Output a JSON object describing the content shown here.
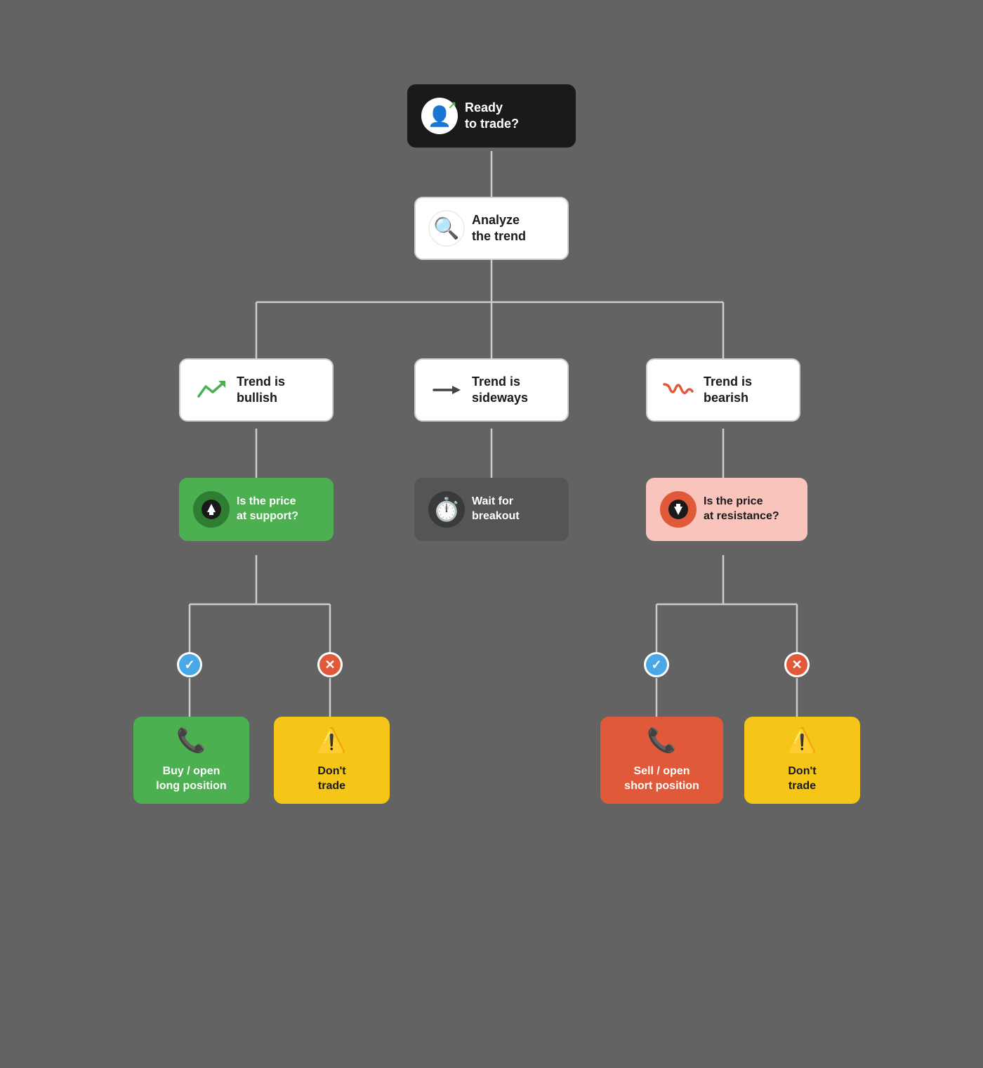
{
  "nodes": {
    "ready": {
      "label": "Ready\nto trade?",
      "icon": "👤"
    },
    "analyze": {
      "label": "Analyze\nthe trend",
      "icon": "🔍"
    },
    "bullish": {
      "label": "Trend is\nbullish",
      "icon": "📈"
    },
    "sideways": {
      "label": "Trend is\nsideways",
      "icon": "➡️"
    },
    "bearish": {
      "label": "Trend is\nbearish",
      "icon": "📉"
    },
    "support": {
      "label": "Is the price\nat support?",
      "icon": "⬆️"
    },
    "waitBreakout": {
      "label": "Wait for\nbreakout",
      "icon": "⏱️"
    },
    "resistance": {
      "label": "Is the price\nat resistance?",
      "icon": "⬇️"
    },
    "buyLong": {
      "label": "Buy / open\nlong position",
      "icon": "📞"
    },
    "dontTrade1": {
      "label": "Don't\ntrade",
      "icon": "⚠️"
    },
    "sellShort": {
      "label": "Sell / open\nshort position",
      "icon": "📞"
    },
    "dontTrade2": {
      "label": "Don't\ntrade",
      "icon": "⚠️"
    }
  }
}
